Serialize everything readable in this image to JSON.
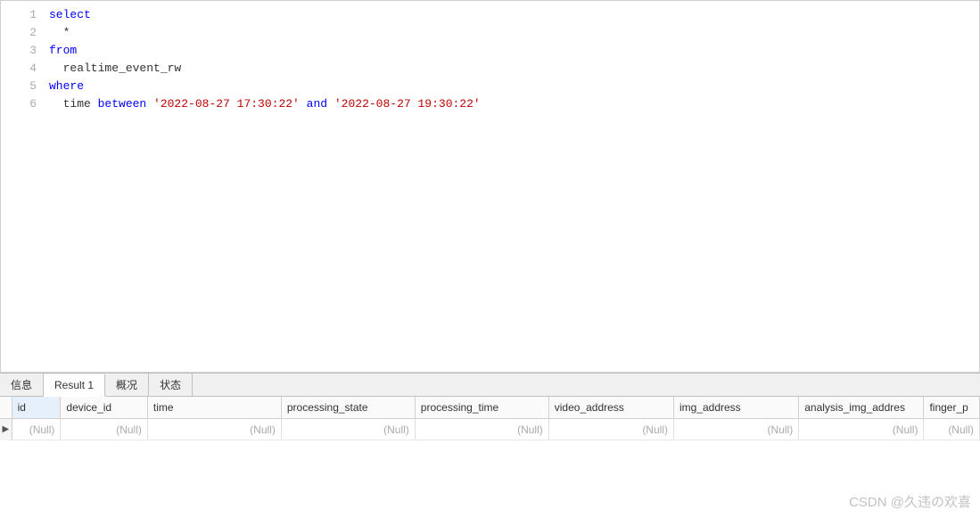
{
  "editor": {
    "lines": [
      [
        {
          "t": "select",
          "c": "kw"
        }
      ],
      [
        {
          "t": "  *",
          "c": "star"
        }
      ],
      [
        {
          "t": "from",
          "c": "kw"
        }
      ],
      [
        {
          "t": "  realtime_event_rw",
          "c": "ident"
        }
      ],
      [
        {
          "t": "where",
          "c": "kw"
        }
      ],
      [
        {
          "t": "  time ",
          "c": "ident"
        },
        {
          "t": "between ",
          "c": "kw"
        },
        {
          "t": "'2022-08-27 17:30:22'",
          "c": "str"
        },
        {
          "t": " and ",
          "c": "kw"
        },
        {
          "t": "'2022-08-27 19:30:22'",
          "c": "str"
        }
      ]
    ]
  },
  "tabs": {
    "items": [
      {
        "label": "信息",
        "active": false
      },
      {
        "label": "Result 1",
        "active": true
      },
      {
        "label": "概况",
        "active": false
      },
      {
        "label": "状态",
        "active": false
      }
    ]
  },
  "grid": {
    "columns": [
      "id",
      "device_id",
      "time",
      "processing_state",
      "processing_time",
      "video_address",
      "img_address",
      "analysis_img_addres",
      "finger_p"
    ],
    "selected_col": 0,
    "rows": [
      {
        "indicator": "▶",
        "cells": [
          "(Null)",
          "(Null)",
          "(Null)",
          "(Null)",
          "(Null)",
          "(Null)",
          "(Null)",
          "(Null)",
          "(Null)"
        ]
      }
    ]
  },
  "watermark": "CSDN @久违の欢喜"
}
